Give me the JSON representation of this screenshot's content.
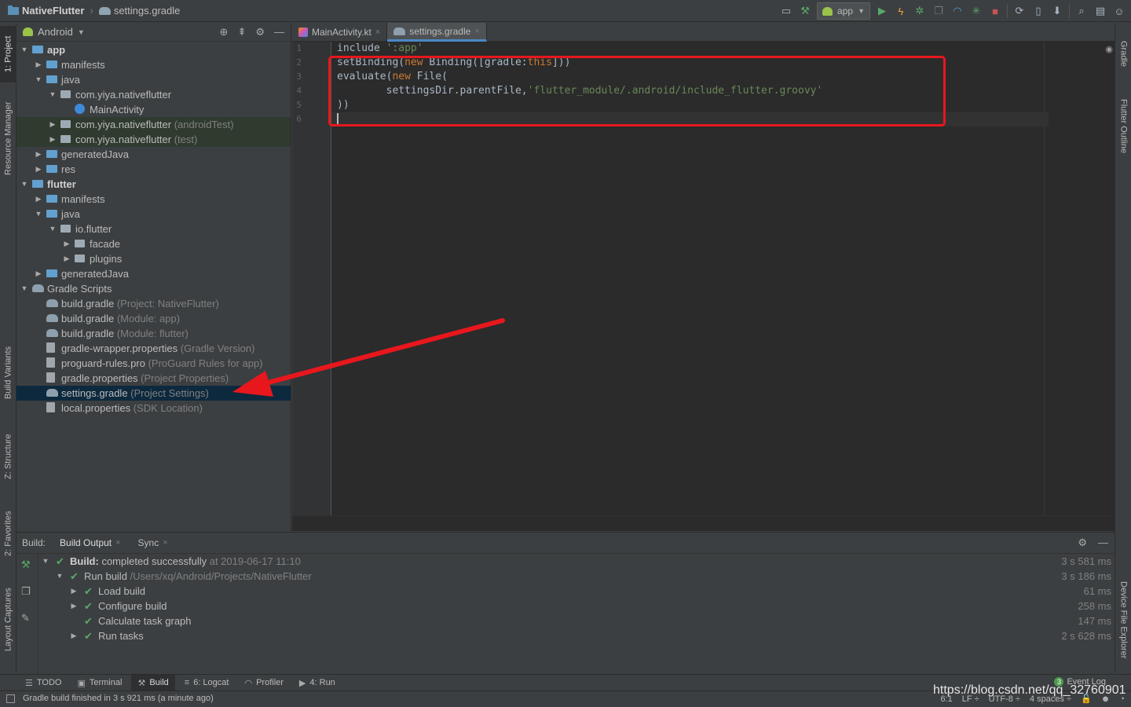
{
  "window": {
    "project_name": "NativeFlutter",
    "breadcrumb_sep": "›",
    "current_file": "settings.gradle"
  },
  "toolbar": {
    "run_config": "app",
    "icons": [
      "layout-icon",
      "hammer-icon",
      "run-icon",
      "apply-changes-icon",
      "debug-icon",
      "attach-icon",
      "profile-icon",
      "bug-icon",
      "stop-icon",
      "sync-icon",
      "device-icon",
      "sdk-icon",
      "search-icon",
      "structure-icon",
      "user-icon"
    ]
  },
  "left_strip": {
    "project": "1: Project",
    "resource_manager": "Resource Manager",
    "build_variants": "Build Variants",
    "structure": "Z: Structure",
    "favorites": "2: Favorites",
    "layout_captures": "Layout Captures"
  },
  "right_strip": {
    "gradle": "Gradle",
    "flutter_outline": "Flutter Outline",
    "device_file_explorer": "Device File Explorer"
  },
  "project_panel": {
    "view": "Android",
    "tree": [
      {
        "label": "app",
        "hint": "",
        "depth": 0,
        "arrow": "down",
        "icon": "module",
        "bold": true,
        "style": ""
      },
      {
        "label": "manifests",
        "hint": "",
        "depth": 1,
        "arrow": "right",
        "icon": "folder",
        "bold": false,
        "style": ""
      },
      {
        "label": "java",
        "hint": "",
        "depth": 1,
        "arrow": "down",
        "icon": "folder",
        "bold": false,
        "style": ""
      },
      {
        "label": "com.yiya.nativeflutter",
        "hint": "",
        "depth": 2,
        "arrow": "down",
        "icon": "package",
        "bold": false,
        "style": ""
      },
      {
        "label": "MainActivity",
        "hint": "",
        "depth": 3,
        "arrow": "",
        "icon": "class",
        "bold": false,
        "style": ""
      },
      {
        "label": "com.yiya.nativeflutter",
        "hint": " (androidTest)",
        "depth": 2,
        "arrow": "right",
        "icon": "package",
        "bold": false,
        "style": "green"
      },
      {
        "label": "com.yiya.nativeflutter",
        "hint": " (test)",
        "depth": 2,
        "arrow": "right",
        "icon": "package",
        "bold": false,
        "style": "green"
      },
      {
        "label": "generatedJava",
        "hint": "",
        "depth": 1,
        "arrow": "right",
        "icon": "folder",
        "bold": false,
        "style": ""
      },
      {
        "label": "res",
        "hint": "",
        "depth": 1,
        "arrow": "right",
        "icon": "folder",
        "bold": false,
        "style": ""
      },
      {
        "label": "flutter",
        "hint": "",
        "depth": 0,
        "arrow": "down",
        "icon": "module",
        "bold": true,
        "style": ""
      },
      {
        "label": "manifests",
        "hint": "",
        "depth": 1,
        "arrow": "right",
        "icon": "folder",
        "bold": false,
        "style": ""
      },
      {
        "label": "java",
        "hint": "",
        "depth": 1,
        "arrow": "down",
        "icon": "folder",
        "bold": false,
        "style": ""
      },
      {
        "label": "io.flutter",
        "hint": "",
        "depth": 2,
        "arrow": "down",
        "icon": "package",
        "bold": false,
        "style": ""
      },
      {
        "label": "facade",
        "hint": "",
        "depth": 3,
        "arrow": "right",
        "icon": "package",
        "bold": false,
        "style": ""
      },
      {
        "label": "plugins",
        "hint": "",
        "depth": 3,
        "arrow": "right",
        "icon": "package",
        "bold": false,
        "style": ""
      },
      {
        "label": "generatedJava",
        "hint": "",
        "depth": 1,
        "arrow": "right",
        "icon": "folder",
        "bold": false,
        "style": ""
      },
      {
        "label": "Gradle Scripts",
        "hint": "",
        "depth": 0,
        "arrow": "down",
        "icon": "gradle",
        "bold": false,
        "style": ""
      },
      {
        "label": "build.gradle",
        "hint": " (Project: NativeFlutter)",
        "depth": 1,
        "arrow": "",
        "icon": "gradle",
        "bold": false,
        "style": ""
      },
      {
        "label": "build.gradle",
        "hint": " (Module: app)",
        "depth": 1,
        "arrow": "",
        "icon": "gradle",
        "bold": false,
        "style": ""
      },
      {
        "label": "build.gradle",
        "hint": " (Module: flutter)",
        "depth": 1,
        "arrow": "",
        "icon": "gradle",
        "bold": false,
        "style": ""
      },
      {
        "label": "gradle-wrapper.properties",
        "hint": " (Gradle Version)",
        "depth": 1,
        "arrow": "",
        "icon": "file",
        "bold": false,
        "style": ""
      },
      {
        "label": "proguard-rules.pro",
        "hint": " (ProGuard Rules for app)",
        "depth": 1,
        "arrow": "",
        "icon": "file",
        "bold": false,
        "style": ""
      },
      {
        "label": "gradle.properties",
        "hint": " (Project Properties)",
        "depth": 1,
        "arrow": "",
        "icon": "file",
        "bold": false,
        "style": ""
      },
      {
        "label": "settings.gradle",
        "hint": " (Project Settings)",
        "depth": 1,
        "arrow": "",
        "icon": "gradle",
        "bold": false,
        "style": "sel"
      },
      {
        "label": "local.properties",
        "hint": " (SDK Location)",
        "depth": 1,
        "arrow": "",
        "icon": "file",
        "bold": false,
        "style": ""
      }
    ]
  },
  "editor": {
    "tabs": [
      {
        "label": "MainActivity.kt",
        "active": false
      },
      {
        "label": "settings.gradle",
        "active": true
      }
    ],
    "close_glyph": "×",
    "line_numbers": [
      "1",
      "2",
      "3",
      "4",
      "5",
      "6"
    ],
    "lines": [
      [
        {
          "t": "include ",
          "c": "plain"
        },
        {
          "t": "':app'",
          "c": "str"
        }
      ],
      [
        {
          "t": "setBinding(",
          "c": "plain"
        },
        {
          "t": "new",
          "c": "kw"
        },
        {
          "t": " Binding([gradle:",
          "c": "plain"
        },
        {
          "t": "this",
          "c": "kw"
        },
        {
          "t": "]))",
          "c": "plain"
        }
      ],
      [
        {
          "t": "evaluate(",
          "c": "plain"
        },
        {
          "t": "new",
          "c": "kw"
        },
        {
          "t": " File(",
          "c": "plain"
        }
      ],
      [
        {
          "t": "        settingsDir.parentFile,",
          "c": "plain"
        },
        {
          "t": "'flutter_module/.android/include_flutter.groovy'",
          "c": "str"
        }
      ],
      [
        {
          "t": "))",
          "c": "plain"
        }
      ],
      []
    ],
    "current_line": 6
  },
  "build_panel": {
    "label": "Build:",
    "tabs": [
      {
        "label": "Build Output",
        "active": true
      },
      {
        "label": "Sync",
        "active": false
      }
    ],
    "tree": [
      {
        "label": "Build:",
        "rest": " completed successfully",
        "hint": " at 2019-06-17 11:10",
        "time": "3 s 581 ms",
        "depth": 0,
        "arrow": "down",
        "bold": true
      },
      {
        "label": "Run build",
        "rest": "",
        "hint": " /Users/xq/Android/Projects/NativeFlutter",
        "time": "3 s 186 ms",
        "depth": 1,
        "arrow": "down",
        "bold": false
      },
      {
        "label": "Load build",
        "rest": "",
        "hint": "",
        "time": "61 ms",
        "depth": 2,
        "arrow": "right",
        "bold": false
      },
      {
        "label": "Configure build",
        "rest": "",
        "hint": "",
        "time": "258 ms",
        "depth": 2,
        "arrow": "right",
        "bold": false
      },
      {
        "label": "Calculate task graph",
        "rest": "",
        "hint": "",
        "time": "147 ms",
        "depth": 2,
        "arrow": "",
        "bold": false
      },
      {
        "label": "Run tasks",
        "rest": "",
        "hint": "",
        "time": "2 s 628 ms",
        "depth": 2,
        "arrow": "right",
        "bold": false
      }
    ]
  },
  "bottom_tabs": [
    {
      "label": "TODO",
      "icon": "☰",
      "active": false
    },
    {
      "label": "Terminal",
      "icon": "▣",
      "active": false
    },
    {
      "label": "Build",
      "icon": "⚒",
      "active": true
    },
    {
      "label": "6: Logcat",
      "icon": "≡",
      "active": false
    },
    {
      "label": "Profiler",
      "icon": "◠",
      "active": false
    },
    {
      "label": "4: Run",
      "icon": "▶",
      "active": false
    }
  ],
  "event_log": {
    "count": "3",
    "label": "Event Log"
  },
  "status": {
    "message": "Gradle build finished in 3 s 921 ms (a minute ago)",
    "position": "6:1",
    "line_sep": "LF ÷",
    "encoding": "UTF-8 ÷",
    "indent": "4 spaces ÷"
  },
  "watermark": "https://blog.csdn.net/qq_32760901",
  "colors": {
    "annotation_red": "#e8171d",
    "success_green": "#59a869",
    "selection_blue": "#0d293e",
    "keyword_orange": "#cc7832",
    "string_green": "#6a8759"
  }
}
